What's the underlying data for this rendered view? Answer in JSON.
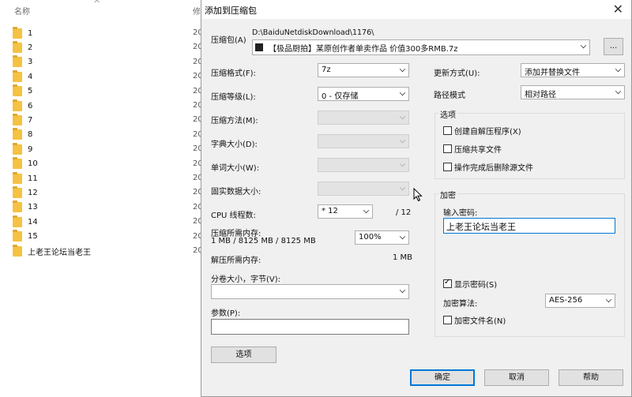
{
  "explorer": {
    "header_name": "名称",
    "header_modified": "修",
    "files": [
      {
        "name": "1",
        "date": "20"
      },
      {
        "name": "2",
        "date": "20"
      },
      {
        "name": "3",
        "date": "20"
      },
      {
        "name": "4",
        "date": "20"
      },
      {
        "name": "5",
        "date": "20"
      },
      {
        "name": "6",
        "date": "20"
      },
      {
        "name": "7",
        "date": "20"
      },
      {
        "name": "8",
        "date": "20"
      },
      {
        "name": "9",
        "date": "20"
      },
      {
        "name": "10",
        "date": "20"
      },
      {
        "name": "11",
        "date": "20"
      },
      {
        "name": "12",
        "date": "20"
      },
      {
        "name": "13",
        "date": "20"
      },
      {
        "name": "14",
        "date": "20"
      },
      {
        "name": "15",
        "date": "20"
      },
      {
        "name": "上老王论坛当老王",
        "date": "20"
      }
    ]
  },
  "dialog": {
    "title": "添加到压缩包",
    "archive_label": "压缩包(A)",
    "archive_path": "D:\\BaiduNetdiskDownload\\1176\\",
    "archive_name": "【极品厨拍】某原创作者单卖作品 价值300多RMB.7z",
    "browse_label": "...",
    "format_label": "压缩格式(F):",
    "format_value": "7z",
    "level_label": "压缩等级(L):",
    "level_value": "0 - 仅存储",
    "method_label": "压缩方法(M):",
    "dict_label": "字典大小(D):",
    "word_label": "单词大小(W):",
    "solid_label": "固实数据大小:",
    "cpu_label": "CPU 线程数:",
    "cpu_value": "* 12",
    "cpu_total": "/ 12",
    "mem_comp_label": "压缩所需内存:",
    "mem_comp_detail": "1 MB / 8125 MB / 8125 MB",
    "mem_percent": "100%",
    "mem_decomp_label": "解压所需内存:",
    "mem_decomp_value": "1 MB",
    "split_label": "分卷大小，字节(V):",
    "split_value": "",
    "params_label": "参数(P):",
    "params_value": "",
    "options_button": "选项",
    "update_label": "更新方式(U):",
    "update_value": "添加并替换文件",
    "path_label": "路径模式",
    "path_value": "相对路径",
    "options_group": "选项",
    "opt_sfx": "创建自解压程序(X)",
    "opt_shared": "压缩共享文件",
    "opt_delete": "操作完成后删除源文件",
    "encrypt_group": "加密",
    "password_label": "输入密码:",
    "password_value": "上老王论坛当老王",
    "show_password": "显示密码(S)",
    "enc_method_label": "加密算法:",
    "enc_method_value": "AES-256",
    "enc_names": "加密文件名(N)",
    "ok": "确定",
    "cancel": "取消",
    "help": "帮助"
  }
}
